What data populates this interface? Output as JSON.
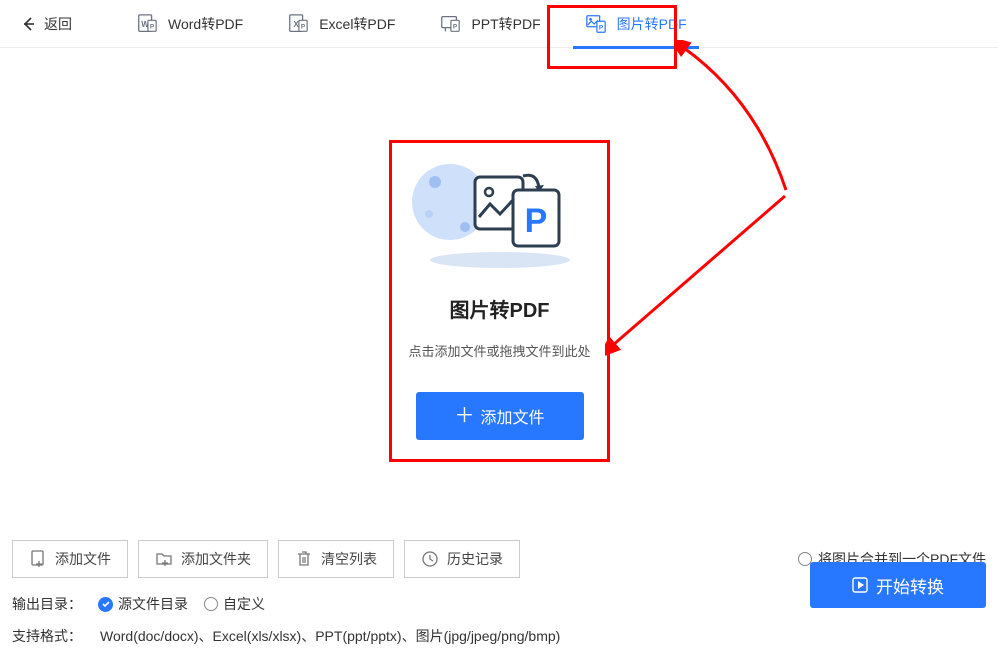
{
  "topbar": {
    "back_label": "返回",
    "tabs": [
      {
        "label": "Word转PDF"
      },
      {
        "label": "Excel转PDF"
      },
      {
        "label": "PPT转PDF"
      },
      {
        "label": "图片转PDF"
      }
    ]
  },
  "drop_panel": {
    "title": "图片转PDF",
    "subtitle": "点击添加文件或拖拽文件到此处",
    "add_button": "添加文件"
  },
  "bottom": {
    "buttons": {
      "add_file": "添加文件",
      "add_folder": "添加文件夹",
      "clear_list": "清空列表",
      "history": "历史记录"
    },
    "merge_option": "将图片合并到一个PDF文件",
    "output_label": "输出目录：",
    "output_source": "源文件目录",
    "output_custom": "自定义",
    "formats_label": "支持格式：",
    "formats_value": "Word(doc/docx)、Excel(xls/xlsx)、PPT(ppt/pptx)、图片(jpg/jpeg/png/bmp)",
    "start_button": "开始转换"
  },
  "colors": {
    "accent": "#2878ff",
    "red": "#ff0000"
  }
}
